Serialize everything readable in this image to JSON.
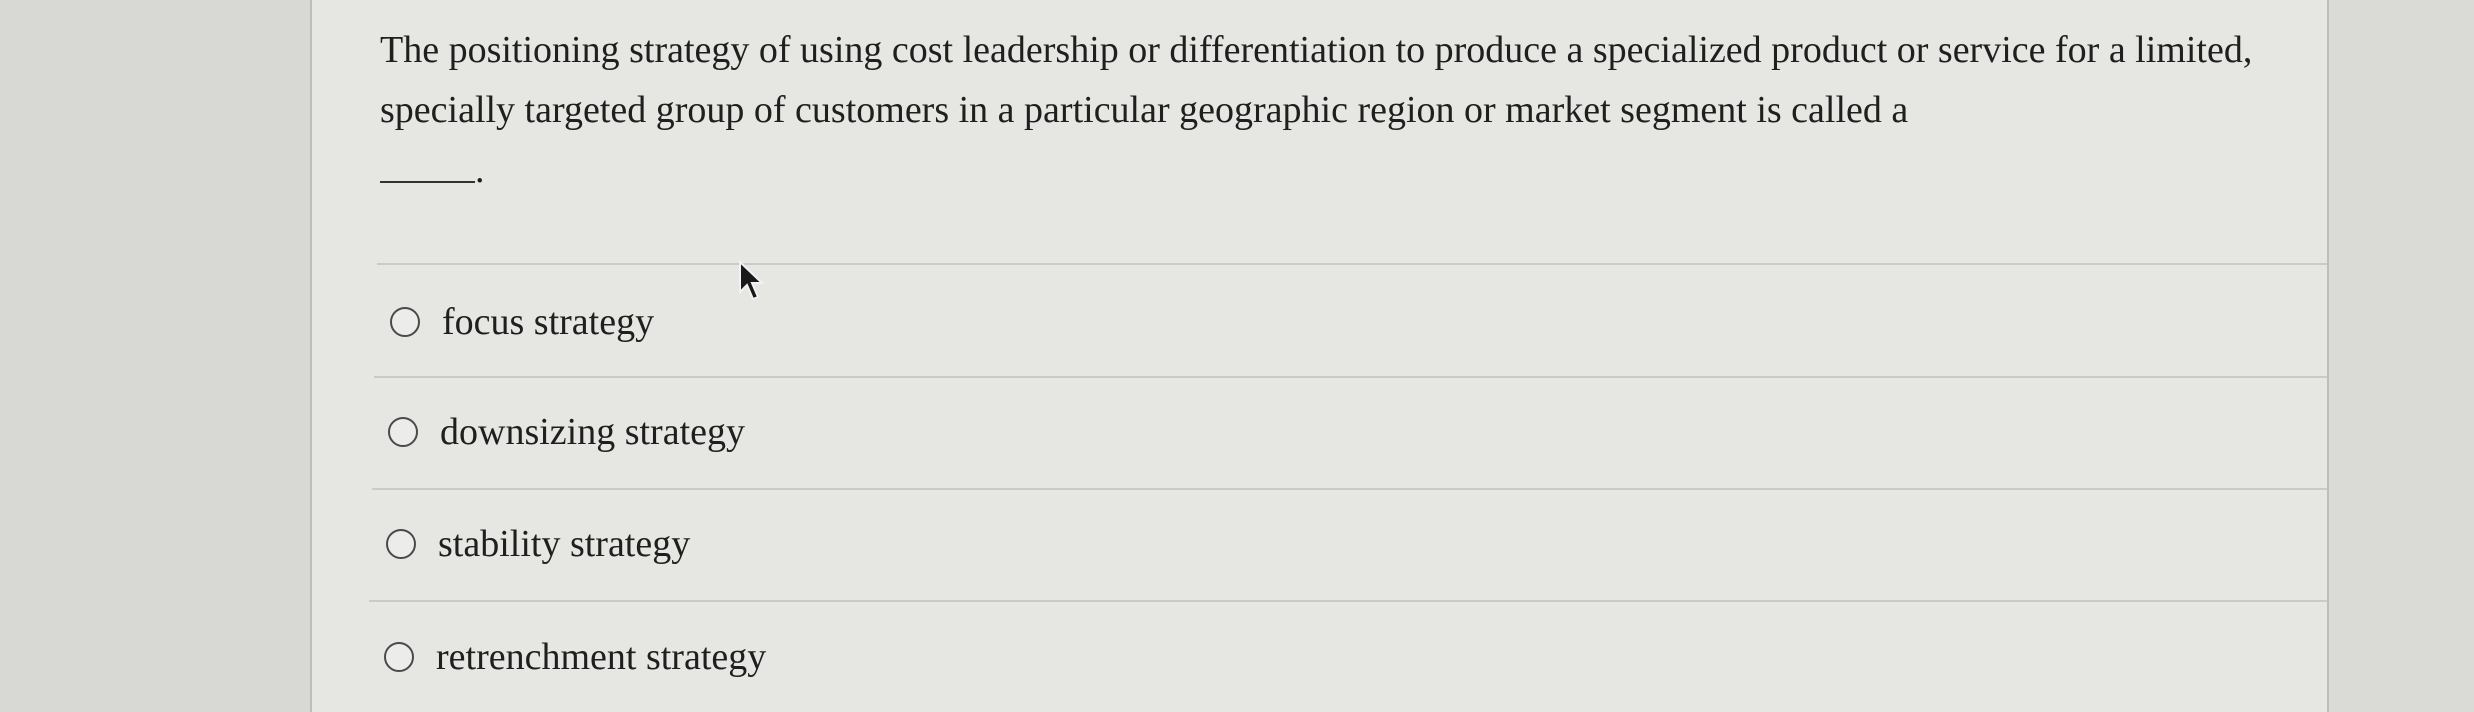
{
  "question": {
    "text": "The positioning strategy of using cost leadership or differentiation to produce a specialized product or service for a limited, specially targeted group of customers in a particular geographic region or market segment is called a",
    "suffix": "."
  },
  "options": [
    {
      "label": "focus strategy"
    },
    {
      "label": "downsizing strategy"
    },
    {
      "label": "stability strategy"
    },
    {
      "label": "retrenchment strategy"
    }
  ],
  "icons": {
    "radio": "radio-button-icon",
    "cursor": "mouse-pointer-icon"
  }
}
